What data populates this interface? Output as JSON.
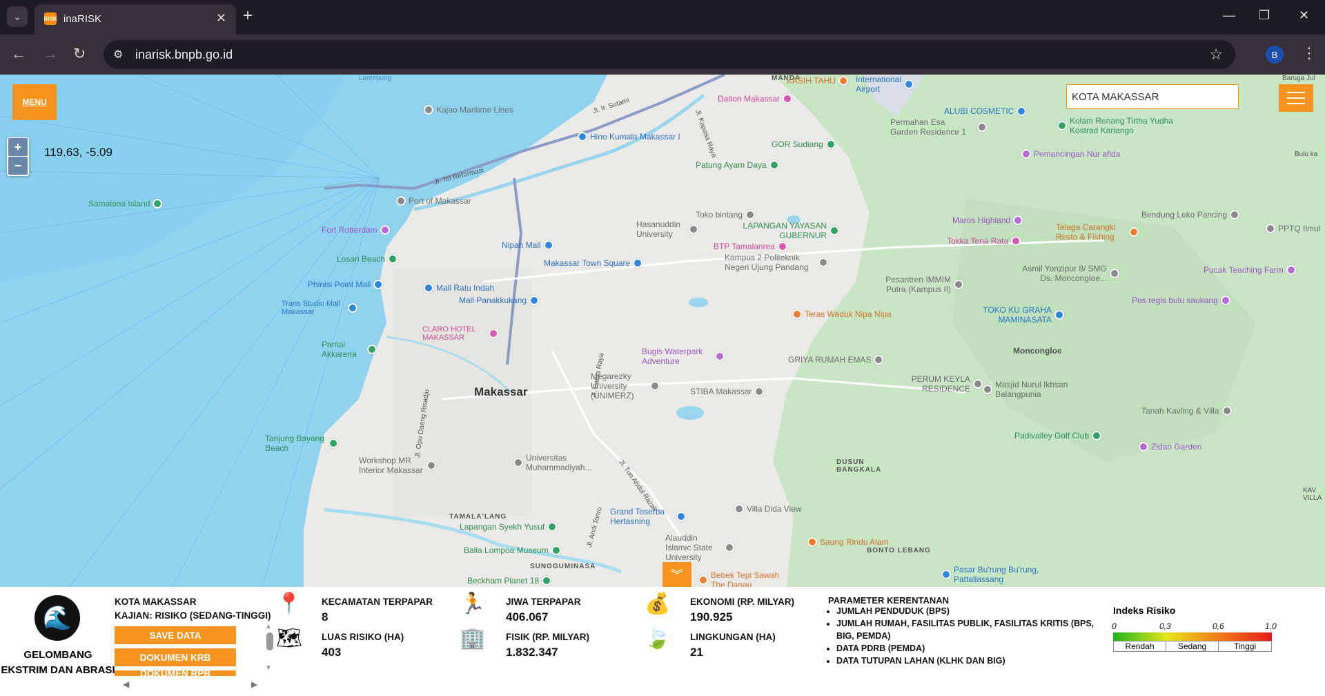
{
  "browser": {
    "tab_title": "inaRISK",
    "tab_favicon_text": "RISK",
    "url": "inarisk.bnpb.go.id",
    "profile_initial": "B"
  },
  "map": {
    "menu_label": "MENU",
    "coordinates": "119.63, -5.09",
    "search_value": "KOTA MAKASSAR",
    "city": "Makassar",
    "pois": [
      {
        "name": "Kajao Maritime Lines",
        "type": "gray"
      },
      {
        "name": "Hino Kumala Makassar I",
        "type": "blue"
      },
      {
        "name": "Samalona Island",
        "type": "green"
      },
      {
        "name": "Port of Makassar",
        "type": "gray"
      },
      {
        "name": "Fort Rotterdam",
        "type": "purple"
      },
      {
        "name": "Losari Beach",
        "type": "green"
      },
      {
        "name": "Phinisi Point Mall",
        "type": "blue"
      },
      {
        "name": "Trans Studio Mall Makassar",
        "type": "blue"
      },
      {
        "name": "Mall Ratu Indah",
        "type": "blue"
      },
      {
        "name": "Mall Panakkukang",
        "type": "blue"
      },
      {
        "name": "Nipah Mall",
        "type": "blue"
      },
      {
        "name": "Makassar Town Square",
        "type": "blue"
      },
      {
        "name": "CLARO HOTEL MAKASSAR",
        "type": "pink"
      },
      {
        "name": "Pantai Akkarena",
        "type": "green"
      },
      {
        "name": "Tanjung Bayang Beach",
        "type": "green"
      },
      {
        "name": "Workshop MR Interior Makassar",
        "type": "gray"
      },
      {
        "name": "Universitas Muhammadiyah...",
        "type": "gray"
      },
      {
        "name": "Lapangan Syekh Yusuf",
        "type": "green"
      },
      {
        "name": "Balla Lompoa Museum",
        "type": "green"
      },
      {
        "name": "Beckham Planet 18",
        "type": "green"
      },
      {
        "name": "Grand Toserba Hertasning",
        "type": "blue"
      },
      {
        "name": "Alauddin Islamic State University",
        "type": "gray"
      },
      {
        "name": "Bebek Tepi Sawah The Danau",
        "type": "orange"
      },
      {
        "name": "Saung Rindu Alam",
        "type": "orange"
      },
      {
        "name": "Villa Dida View",
        "type": "gray"
      },
      {
        "name": "Megarezky University (UNIMERZ)",
        "type": "gray"
      },
      {
        "name": "STIBA Makassar",
        "type": "gray"
      },
      {
        "name": "Bugis Waterpark Adventure",
        "type": "purple"
      },
      {
        "name": "BTP Tamalanrea",
        "type": "pink"
      },
      {
        "name": "Hasanuddin University",
        "type": "gray"
      },
      {
        "name": "Toko bintang",
        "type": "gray"
      },
      {
        "name": "Kampus 2 Politeknik Negeri Ujung Pandang",
        "type": "gray"
      },
      {
        "name": "Patung Ayam Daya",
        "type": "green"
      },
      {
        "name": "GOR Sudiang",
        "type": "green"
      },
      {
        "name": "LAPANGAN YAYASAN GUBERNUR",
        "type": "green"
      },
      {
        "name": "Dalton Makassar",
        "type": "pink"
      },
      {
        "name": "KASIH TAHU",
        "type": "orange"
      },
      {
        "name": "International Airport",
        "type": "blue"
      },
      {
        "name": "ALUBI COSMETIC",
        "type": "blue"
      },
      {
        "name": "Permahan Esa Garden Residence 1",
        "type": "gray"
      },
      {
        "name": "Kolam Renang Tirtha Yudha Kostrad Kariango",
        "type": "green"
      },
      {
        "name": "Pemancingan Nur afida",
        "type": "purple"
      },
      {
        "name": "Telaga Carangki Resto & Fishing",
        "type": "orange"
      },
      {
        "name": "Maros Highland",
        "type": "purple"
      },
      {
        "name": "Tokka Tena Rata",
        "type": "pink"
      },
      {
        "name": "Bendung Leko Pancing",
        "type": "gray"
      },
      {
        "name": "PPTQ Ilmul",
        "type": "gray"
      },
      {
        "name": "Asmil Yonzipur 8/ SMG Ds. Moncongloe...",
        "type": "gray"
      },
      {
        "name": "Pesantren IMMIM Putra (Kampus II)",
        "type": "gray"
      },
      {
        "name": "Pucak Teaching Farm",
        "type": "purple"
      },
      {
        "name": "Pos regis bulu saukang",
        "type": "purple"
      },
      {
        "name": "TOKO KU GRAHA MAMINASATA",
        "type": "blue"
      },
      {
        "name": "Teras Waduk Nipa Nipa",
        "type": "orange"
      },
      {
        "name": "GRIYA RUMAH EMAS",
        "type": "gray"
      },
      {
        "name": "PERUM KEYLA RESIDENCE",
        "type": "gray"
      },
      {
        "name": "Masjid Nurul Ikhsan Balangpunia",
        "type": "gray"
      },
      {
        "name": "Tanah Kavling & Villa",
        "type": "gray"
      },
      {
        "name": "Padivalley Golf Club",
        "type": "green"
      },
      {
        "name": "Zidan Garden",
        "type": "purple"
      },
      {
        "name": "Pasar Bu'rung Bu'rung, Pattallassang",
        "type": "blue"
      }
    ],
    "areas": [
      "TAMALA'LANG",
      "SUNGGUMINASA",
      "DUSUN BANGKALA",
      "BONTO LEBANG",
      "Moncongloe",
      "MANDA"
    ],
    "roads": [
      "Jl. Ir. Sutami",
      "Jl. Tol Reformasi",
      "Jl. Kapasa Raya",
      "Jl. Batua Raya",
      "Jl. Opu Daeng Risadju",
      "Jl. Tun Abdul Razak",
      "Jl. Andi Tonro"
    ],
    "other_labels": [
      "Lantebung",
      "Bulu ka",
      "Baruga Jul",
      "KAV VILLA"
    ]
  },
  "panel": {
    "hazard_name": "GELOMBANG EKSTRIM DAN ABRASI",
    "region": "KOTA MAKASSAR",
    "kajian": "KAJIAN: RISIKO (SEDANG-TINGGI)",
    "buttons": [
      "SAVE DATA",
      "DOKUMEN KRB",
      "DOKUMEN RPB"
    ],
    "stats": {
      "kecamatan_label": "KECAMATAN TERPAPAR",
      "kecamatan_value": "8",
      "luas_label": "LUAS RISIKO (HA)",
      "luas_value": "403",
      "jiwa_label": "JIWA TERPAPAR",
      "jiwa_value": "406.067",
      "fisik_label": "FISIK (RP. MILYAR)",
      "fisik_value": "1.832.347",
      "ekonomi_label": "EKONOMI (RP. MILYAR)",
      "ekonomi_value": "190.925",
      "lingkungan_label": "LINGKUNGAN (HA)",
      "lingkungan_value": "21"
    },
    "parameter_title": "PARAMETER KERENTANAN",
    "parameters": [
      "JUMLAH PENDUDUK (BPS)",
      "JUMLAH RUMAH, FASILITAS PUBLIK, FASILITAS KRITIS (BPS, BIG, PEMDA)",
      "DATA PDRB (PEMDA)",
      "DATA TUTUPAN LAHAN (KLHK DAN BIG)"
    ],
    "legend": {
      "title": "Indeks Risiko",
      "ticks": [
        "0",
        "0,3",
        "0,6",
        "1,0"
      ],
      "classes": [
        "Rendah",
        "Sedang",
        "Tinggi"
      ],
      "colors": [
        "#1db41d",
        "#e5e51a",
        "#f07c1a",
        "#e41c1c"
      ]
    }
  }
}
